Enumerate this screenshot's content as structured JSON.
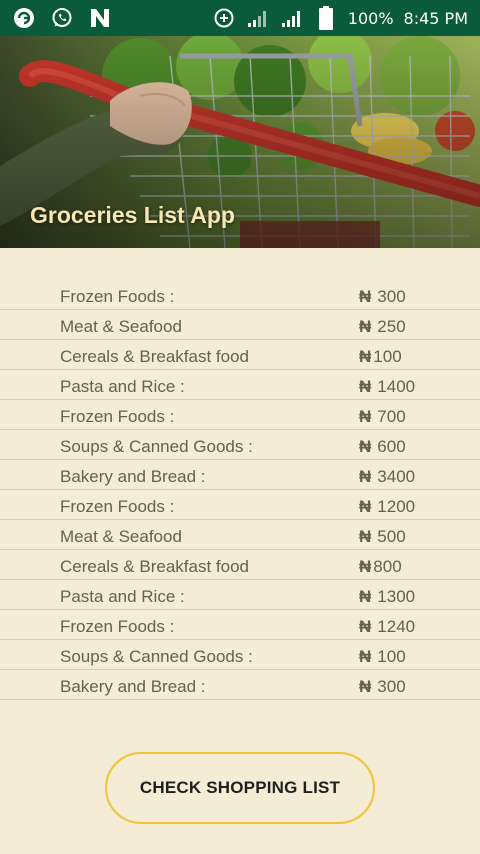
{
  "status_bar": {
    "battery": "100%",
    "time": "8:45 PM",
    "icons": [
      "app-g-icon",
      "whatsapp-icon",
      "n-icon",
      "data-saver-icon",
      "signal-icon",
      "signal-icon",
      "battery-icon"
    ]
  },
  "header": {
    "title": "Groceries List App",
    "image": "shopping-cart-with-vegetables"
  },
  "items": [
    {
      "name": "Frozen Foods :",
      "currency": "₦",
      "price": "300"
    },
    {
      "name": "Meat & Seafood",
      "currency": "₦",
      "price": "250"
    },
    {
      "name": "Cereals & Breakfast food",
      "currency": "₦",
      "price": "100"
    },
    {
      "name": "Pasta and Rice :",
      "currency": "₦",
      "price": "1400"
    },
    {
      "name": "Frozen Foods :",
      "currency": "₦",
      "price": "700"
    },
    {
      "name": "Soups & Canned Goods :",
      "currency": "₦",
      "price": "600"
    },
    {
      "name": "Bakery and Bread :",
      "currency": "₦",
      "price": "3400"
    },
    {
      "name": "Frozen Foods :",
      "currency": "₦",
      "price": "1200"
    },
    {
      "name": "Meat & Seafood",
      "currency": "₦",
      "price": "500"
    },
    {
      "name": "Cereals & Breakfast food",
      "currency": "₦",
      "price": "800"
    },
    {
      "name": "Pasta and Rice :",
      "currency": "₦",
      "price": "1300"
    },
    {
      "name": "Frozen Foods :",
      "currency": "₦",
      "price": "1240"
    },
    {
      "name": "Soups & Canned Goods :",
      "currency": "₦",
      "price": "100"
    },
    {
      "name": "Bakery and Bread :",
      "currency": "₦",
      "price": "300"
    }
  ],
  "button": {
    "label": "CHECK SHOPPING LIST"
  },
  "colors": {
    "status_bar": "#0a5a3c",
    "background": "#f5ecd6",
    "title_text": "#f7e7b3",
    "button_border": "#f1c232"
  }
}
